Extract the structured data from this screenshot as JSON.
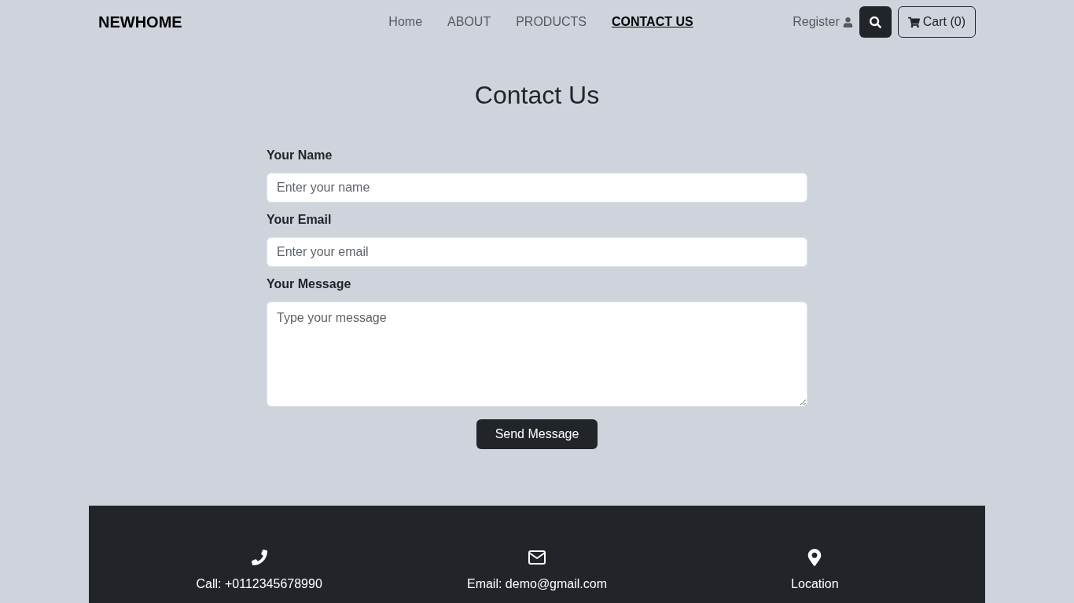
{
  "brand": "NEWHOME",
  "nav": [
    {
      "label": "Home",
      "selected": false
    },
    {
      "label": "ABOUT",
      "selected": false
    },
    {
      "label": "PRODUCTS",
      "selected": false
    },
    {
      "label": "CONTACT US",
      "selected": true
    }
  ],
  "register": "Register",
  "cart": "Cart (0)",
  "title": "Contact Us",
  "fields": [
    {
      "kind": "input",
      "label": "Your Name",
      "placeholder": "Enter your name"
    },
    {
      "kind": "input",
      "label": "Your Email",
      "placeholder": "Enter your email"
    },
    {
      "kind": "textarea",
      "label": "Your Message",
      "placeholder": "Type your message"
    }
  ],
  "submit": "Send Message",
  "footer": [
    {
      "kind": "phone",
      "text": "Call: +0112345678990"
    },
    {
      "kind": "mail",
      "text": "Email: demo@gmail.com"
    },
    {
      "kind": "pin",
      "text": "Location"
    }
  ]
}
